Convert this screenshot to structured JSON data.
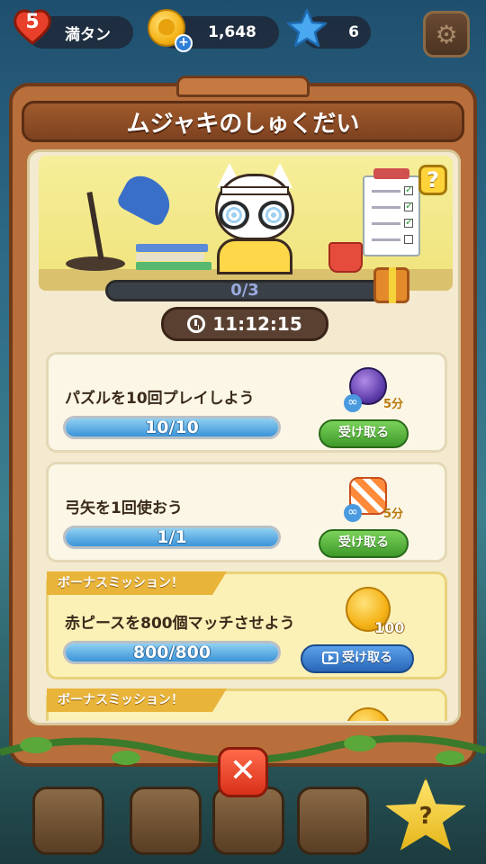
{
  "hud": {
    "lives": "5",
    "lives_label": "満タン",
    "coins": "1,648",
    "stars": "6"
  },
  "title": "ムジャキのしゅくだい",
  "progress": {
    "label": "0/3",
    "value": 0,
    "max": 3
  },
  "timer": "11:12:15",
  "help": "?",
  "missions": [
    {
      "title": "パズルを10回プレイしよう",
      "progress_label": "10/10",
      "fraction": 1.0,
      "reward_label": "5分",
      "button_label": "受け取る"
    },
    {
      "title": "弓矢を1回使おう",
      "progress_label": "1/1",
      "fraction": 1.0,
      "reward_label": "5分",
      "button_label": "受け取る"
    },
    {
      "tag": "ボーナスミッション！",
      "title": "赤ピースを800個マッチさせよう",
      "progress_label": "800/800",
      "fraction": 1.0,
      "reward_label": "100",
      "button_label": "受け取る"
    },
    {
      "tag": "ボーナスミッション！"
    }
  ],
  "bottom": {
    "close_glyph": "✕",
    "help_glyph": "?"
  },
  "colors": {
    "claim_green": "#3f9a2a",
    "claim_blue": "#2a66b8",
    "bar_fill": "#3b93d8",
    "wood": "#b86f3c"
  }
}
